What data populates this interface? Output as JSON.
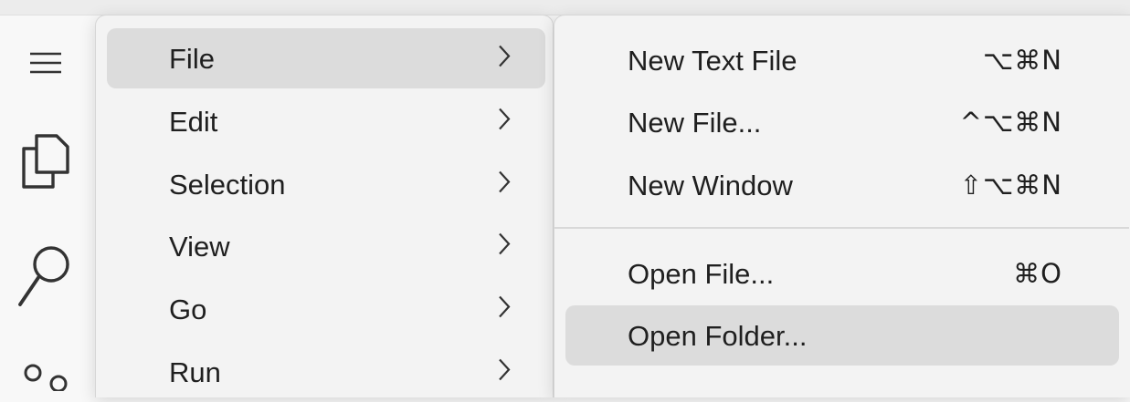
{
  "activity_bar": {
    "icons": [
      "menu-icon",
      "explorer-icon",
      "search-icon",
      "source-control-icon"
    ]
  },
  "main_menu": {
    "items": [
      {
        "label": "File"
      },
      {
        "label": "Edit"
      },
      {
        "label": "Selection"
      },
      {
        "label": "View"
      },
      {
        "label": "Go"
      },
      {
        "label": "Run"
      }
    ],
    "selected": "File"
  },
  "file_menu": {
    "items": [
      {
        "label": "New Text File",
        "shortcut": "⌥⌘N"
      },
      {
        "label": "New File...",
        "shortcut": "^⌥⌘N"
      },
      {
        "label": "New Window",
        "shortcut": "⇧⌥⌘N"
      },
      {
        "label": "Open File...",
        "shortcut": "⌘O"
      },
      {
        "label": "Open Folder...",
        "shortcut": ""
      }
    ],
    "selected": "Open Folder..."
  },
  "colors": {
    "menu_bg": "#f3f3f3",
    "selection_bg": "#dcdcdc",
    "text": "#1f1f1f"
  }
}
